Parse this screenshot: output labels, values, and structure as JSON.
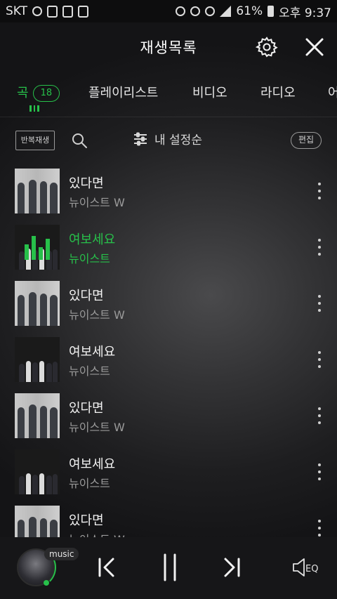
{
  "status_bar": {
    "carrier": "SKT",
    "battery": "61%",
    "time": "오후 9:37"
  },
  "header": {
    "title": "재생목록",
    "settings_icon": "gear-icon",
    "close_icon": "close-icon"
  },
  "tabs": [
    {
      "label": "곡",
      "count": "18",
      "active": true
    },
    {
      "label": "플레이리스트",
      "active": false
    },
    {
      "label": "비디오",
      "active": false
    },
    {
      "label": "라디오",
      "active": false
    },
    {
      "label": "어",
      "active": false
    }
  ],
  "toolbar": {
    "repeat_label": "반복재생",
    "search_icon": "search-icon",
    "sort_label": "내 설정순",
    "edit_label": "편집"
  },
  "songs": [
    {
      "title": "있다면",
      "artist": "뉴이스트 W",
      "playing": false,
      "cover": "light"
    },
    {
      "title": "여보세요",
      "artist": "뉴이스트",
      "playing": true,
      "cover": "dark"
    },
    {
      "title": "있다면",
      "artist": "뉴이스트 W",
      "playing": false,
      "cover": "light"
    },
    {
      "title": "여보세요",
      "artist": "뉴이스트",
      "playing": false,
      "cover": "dark"
    },
    {
      "title": "있다면",
      "artist": "뉴이스트 W",
      "playing": false,
      "cover": "light"
    },
    {
      "title": "여보세요",
      "artist": "뉴이스트",
      "playing": false,
      "cover": "dark"
    },
    {
      "title": "있다면",
      "artist": "뉴이스트 W",
      "playing": false,
      "cover": "light"
    }
  ],
  "player": {
    "badge": "music",
    "controls": [
      "previous-icon",
      "pause-icon",
      "next-icon",
      "equalizer-icon"
    ],
    "eq_label": "EQ"
  },
  "colors": {
    "accent": "#27c04a",
    "background": "#1e1e20",
    "text_primary": "#f2f2f2",
    "text_secondary": "#9a9a9a"
  }
}
